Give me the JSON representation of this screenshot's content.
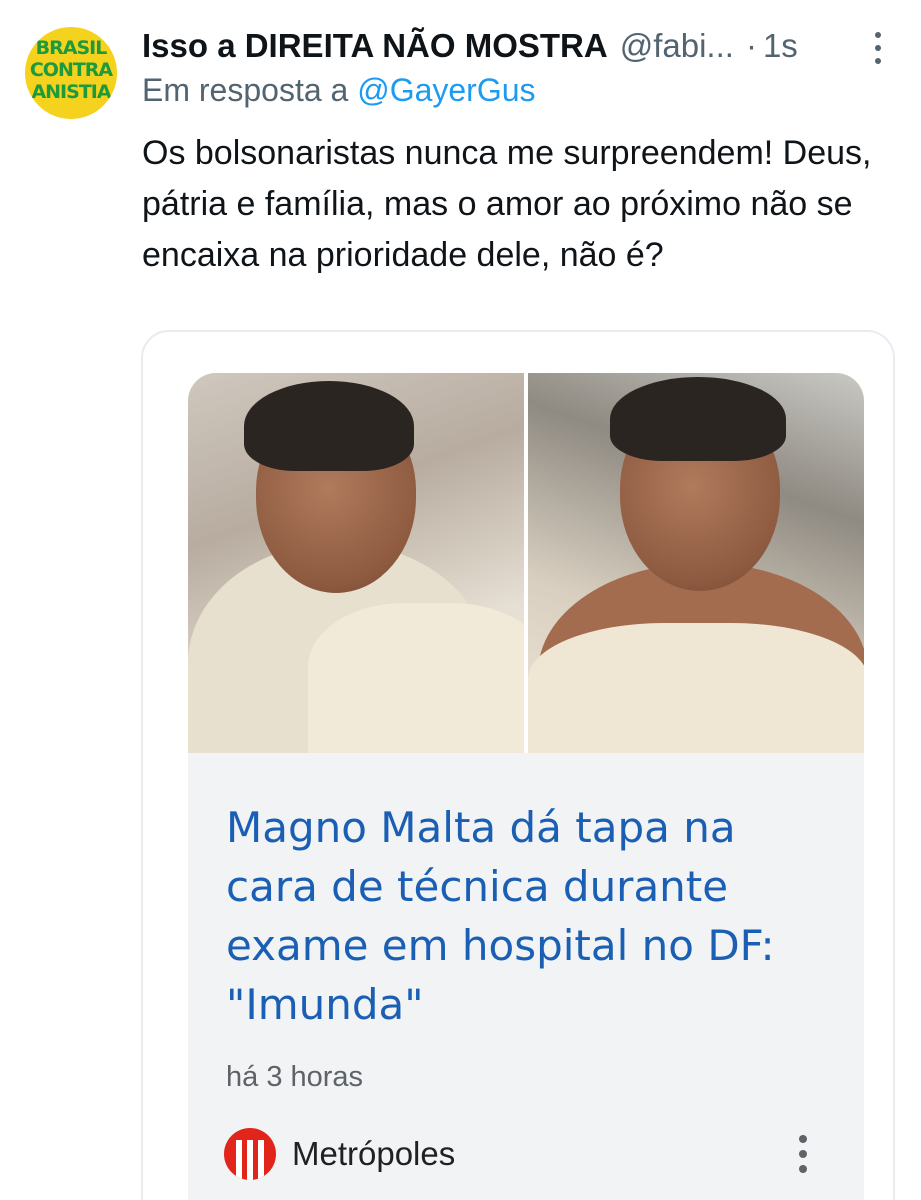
{
  "tweet": {
    "avatar_text": "BRASIL\nCONTRA\nANISTIA",
    "author_name": "Isso a DIREITA NÃO MOSTRA",
    "author_handle": "@fabi...",
    "separator": "·",
    "time": "1s",
    "reply_prefix": "Em resposta a ",
    "reply_to": "@GayerGus",
    "text": "Os bolsonaristas nunca me surpreendem! Deus, pátria e família, mas o amor ao próximo não se encaixa na prioridade dele, não é?"
  },
  "news_card": {
    "title": "Magno Malta dá tapa na cara de técnica durante exame em hospital no DF: \"Imunda\"",
    "time": "há 3 horas",
    "source": "Metrópoles"
  },
  "icons": {
    "more": "more-vertical-icon",
    "news_more": "more-vertical-icon",
    "source_logo": "metropoles-logo"
  },
  "colors": {
    "accent": "#1d9bf0",
    "news_title": "#1a5fb4",
    "avatar_bg": "#f4d21e",
    "avatar_text": "#1c9a3c",
    "source_logo": "#e1251b"
  }
}
